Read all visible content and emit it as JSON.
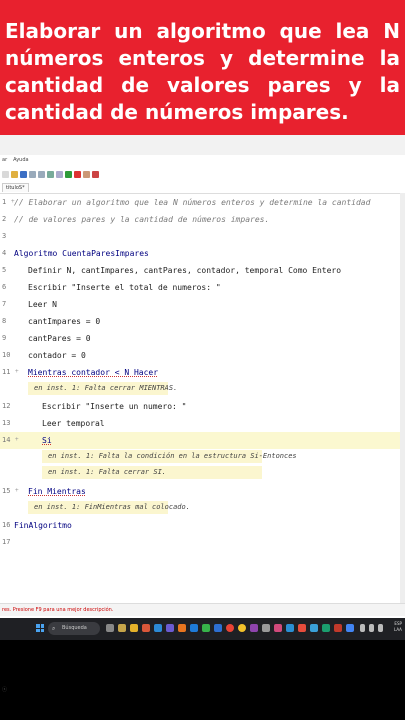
{
  "banner": {
    "text": "Elaborar un algoritmo que lea N números enteros y determine la cantidad de valores pares y la cantidad de números impares.",
    "background": "#e8212e"
  },
  "menubar": {
    "items": [
      "ar",
      "Ayuda"
    ]
  },
  "tab": {
    "label": "tituloS*"
  },
  "editor": {
    "lines": [
      {
        "num": "1",
        "fold": "+",
        "text": "// Elaborar un algoritmo que lea N números enteros y determine la cantidad"
      },
      {
        "num": "2",
        "fold": "",
        "text": "// de valores pares y la cantidad de números impares."
      },
      {
        "num": "3",
        "fold": "",
        "text": ""
      },
      {
        "num": "4",
        "fold": "",
        "text": "Algoritmo CuentaParesImpares"
      },
      {
        "num": "5",
        "fold": "",
        "text": "Definir N, cantImpares, cantPares, contador, temporal Como Entero"
      },
      {
        "num": "6",
        "fold": "",
        "text": "Escribir \"Inserte el total de numeros: \""
      },
      {
        "num": "7",
        "fold": "",
        "text": "Leer N"
      },
      {
        "num": "8",
        "fold": "",
        "text": "cantImpares = 0"
      },
      {
        "num": "9",
        "fold": "",
        "text": "cantPares = 0"
      },
      {
        "num": "10",
        "fold": "",
        "text": "contador = 0"
      },
      {
        "num": "11",
        "fold": "+",
        "text": "Mientras contador < N Hacer"
      },
      {
        "num": "12",
        "fold": "",
        "text": "Escribir \"Inserte un numero: \""
      },
      {
        "num": "13",
        "fold": "",
        "text": "Leer temporal"
      },
      {
        "num": "14",
        "fold": "+",
        "text": "Si"
      },
      {
        "num": "15",
        "fold": "+",
        "text": "Fin Mientras"
      },
      {
        "num": "16",
        "fold": "",
        "text": "FinAlgoritmo"
      },
      {
        "num": "17",
        "fold": "",
        "text": ""
      }
    ],
    "errors": {
      "e1": "en inst. 1: Falta cerrar MIENTRAS.",
      "e2": "en inst. 1: Falta la condición en la estructura Si-Entonces",
      "e3": "en inst. 1: Falta cerrar SI.",
      "e4": "en inst. 1: FinMientras mal colocado."
    }
  },
  "statusbar": {
    "text": "res. Presione F9 para una mejor descripción."
  },
  "taskbar": {
    "search_label": "Búsqueda",
    "clock_line1": "ESP",
    "clock_line2": "LAA"
  },
  "colors": {
    "accent": "#e8212e",
    "highlight": "#fbf6cf",
    "keyword": "#000080",
    "taskbar": "#1f2024"
  },
  "icons": [
    "new-file-icon",
    "open-icon",
    "save-icon",
    "run-icon",
    "step-icon",
    "help-icon",
    "search-icon",
    "windows-start-icon"
  ]
}
